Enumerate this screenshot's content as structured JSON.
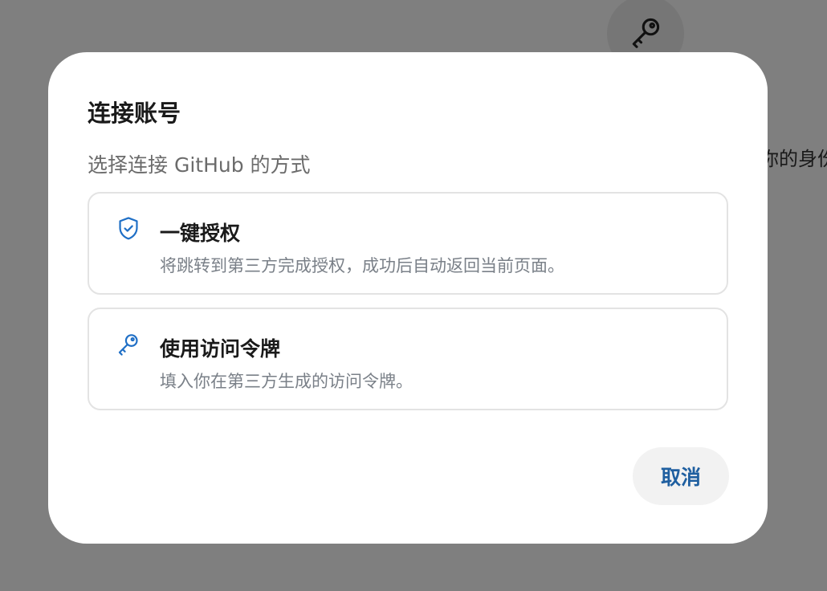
{
  "background": {
    "side_text": "你的身份"
  },
  "dialog": {
    "title": "连接账号",
    "subtitle": "选择连接 GitHub 的方式",
    "options": [
      {
        "icon": "shield-check-icon",
        "title": "一键授权",
        "description": "将跳转到第三方完成授权，成功后自动返回当前页面。"
      },
      {
        "icon": "key-icon",
        "title": "使用访问令牌",
        "description": "填入你在第三方生成的访问令牌。"
      }
    ],
    "cancel_label": "取消"
  },
  "colors": {
    "accent": "#1f6fc6",
    "cancel_text": "#1f5fa0",
    "overlay": "rgba(0,0,0,0.5)"
  }
}
